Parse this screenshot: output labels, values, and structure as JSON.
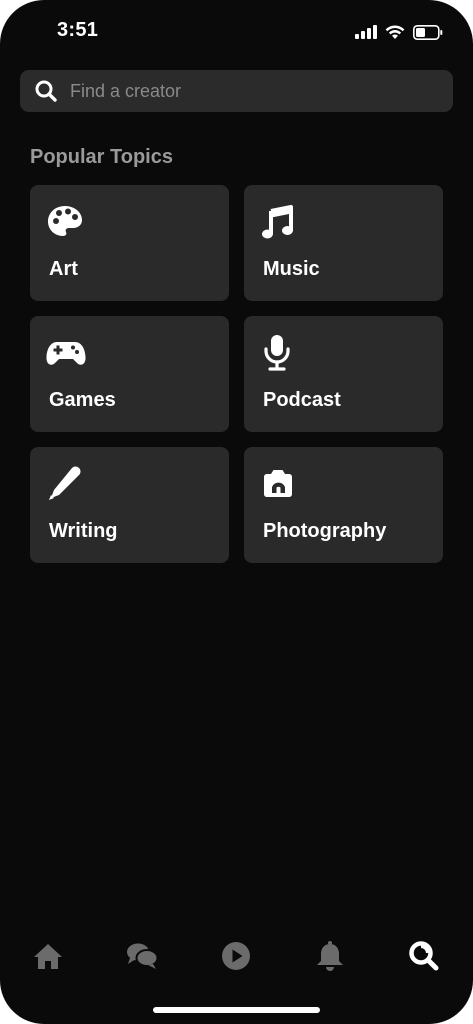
{
  "status_bar": {
    "time": "3:51"
  },
  "search": {
    "placeholder": "Find a creator",
    "value": ""
  },
  "section_title": "Popular Topics",
  "topics": [
    {
      "label": "Art",
      "icon": "palette-icon"
    },
    {
      "label": "Music",
      "icon": "music-note-icon"
    },
    {
      "label": "Games",
      "icon": "gamepad-icon"
    },
    {
      "label": "Podcast",
      "icon": "microphone-icon"
    },
    {
      "label": "Writing",
      "icon": "pencil-icon"
    },
    {
      "label": "Photography",
      "icon": "camera-icon"
    }
  ],
  "bottom_nav": [
    {
      "icon": "home-icon",
      "active": false
    },
    {
      "icon": "chat-icon",
      "active": false
    },
    {
      "icon": "play-icon",
      "active": false
    },
    {
      "icon": "bell-icon",
      "active": false
    },
    {
      "icon": "search-icon",
      "active": true
    }
  ],
  "colors": {
    "background": "#0a0a0a",
    "card": "#2a2a2a",
    "search_bg": "#2b2b2b",
    "inactive_icon": "#6b6b6b",
    "active_icon": "#ffffff"
  }
}
